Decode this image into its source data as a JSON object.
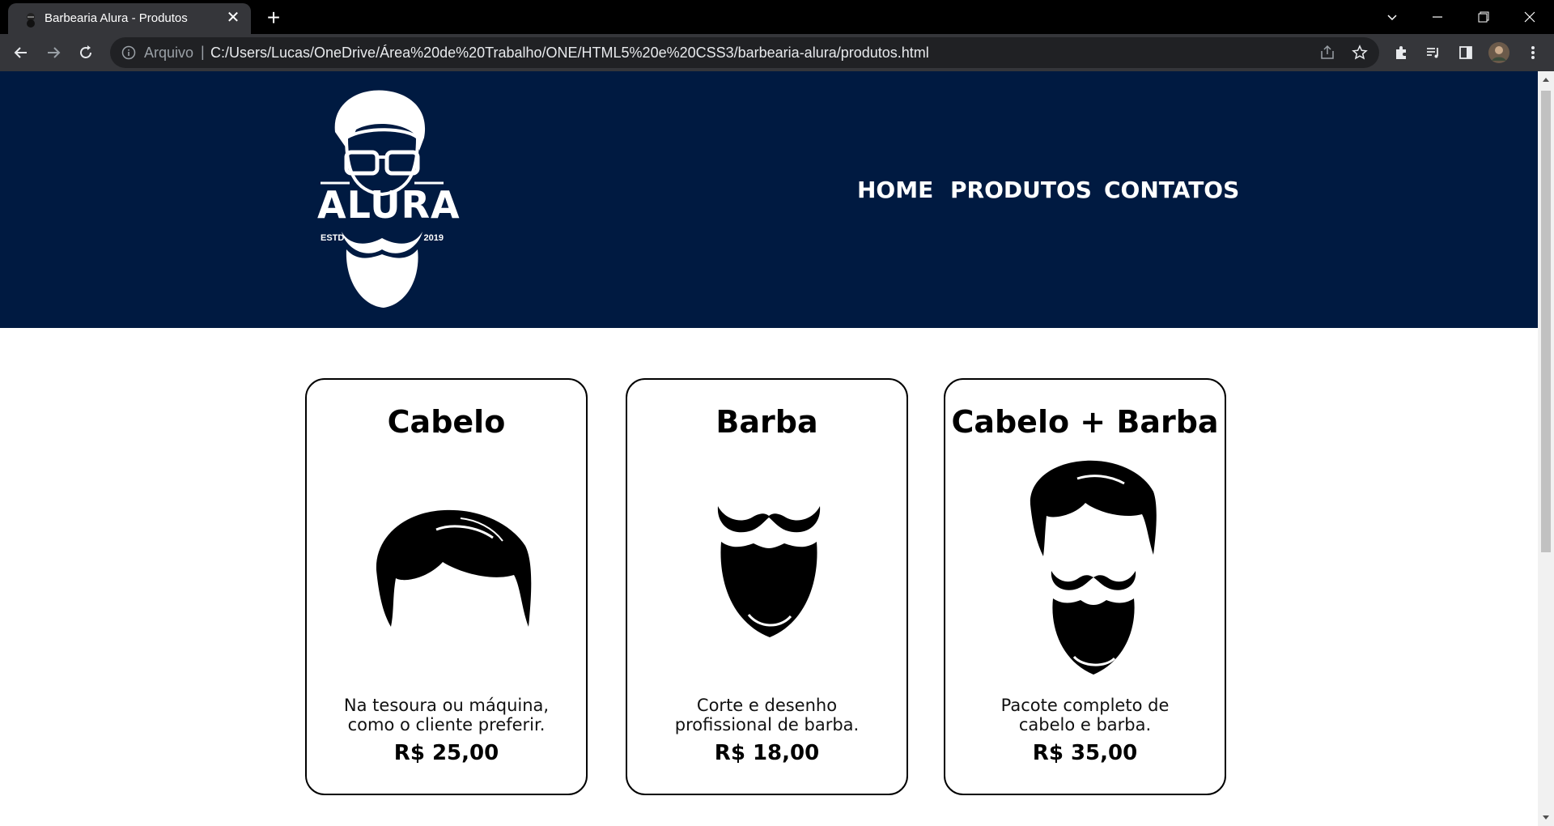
{
  "browser": {
    "tab_title": "Barbearia Alura - Produtos",
    "scheme_label": "Arquivo",
    "separator": "|",
    "url": "C:/Users/Lucas/OneDrive/Área%20de%20Trabalho/ONE/HTML5%20e%20CSS3/barbearia-alura/produtos.html"
  },
  "header": {
    "logo": {
      "word": "ALURA",
      "estd": "ESTD",
      "year": "2019"
    },
    "nav": [
      {
        "label": "HOME"
      },
      {
        "label": "PRODUTOS"
      },
      {
        "label": "CONTATOS"
      }
    ]
  },
  "products": [
    {
      "title": "Cabelo",
      "desc_line1": "Na tesoura ou máquina,",
      "desc_line2": "como o cliente preferir.",
      "price": "R$ 25,00",
      "icon": "hair-icon"
    },
    {
      "title": "Barba",
      "desc_line1": "Corte e desenho",
      "desc_line2": "profissional de barba.",
      "price": "R$ 18,00",
      "icon": "beard-icon"
    },
    {
      "title": "Cabelo + Barba",
      "desc_line1": "Pacote completo de",
      "desc_line2": "cabelo e barba.",
      "price": "R$ 35,00",
      "icon": "hair-and-beard-icon"
    }
  ],
  "colors": {
    "header_bg": "#001a41",
    "chrome_bg": "#35363a",
    "tabbar_bg": "#000000"
  }
}
